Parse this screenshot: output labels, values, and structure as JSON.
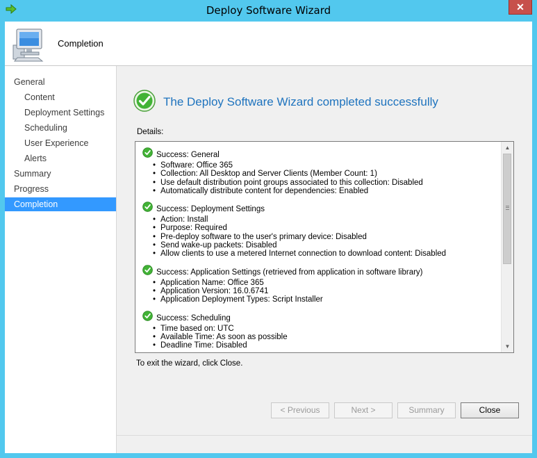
{
  "window": {
    "title": "Deploy Software Wizard",
    "close_glyph": "✕"
  },
  "header": {
    "heading": "Completion"
  },
  "sidebar": {
    "items": [
      {
        "label": "General",
        "level": "top",
        "active": false
      },
      {
        "label": "Content",
        "level": "sub",
        "active": false
      },
      {
        "label": "Deployment Settings",
        "level": "sub",
        "active": false
      },
      {
        "label": "Scheduling",
        "level": "sub",
        "active": false
      },
      {
        "label": "User Experience",
        "level": "sub",
        "active": false
      },
      {
        "label": "Alerts",
        "level": "sub",
        "active": false
      },
      {
        "label": "Summary",
        "level": "top",
        "active": false
      },
      {
        "label": "Progress",
        "level": "top",
        "active": false
      },
      {
        "label": "Completion",
        "level": "top",
        "active": true
      }
    ]
  },
  "main": {
    "success_title": "The Deploy Software Wizard completed successfully",
    "details_label": "Details:",
    "sections": [
      {
        "heading": "Success: General",
        "items": [
          "Software: Office 365",
          "Collection: All Desktop and Server Clients (Member Count: 1)",
          "Use default distribution point groups associated to this collection: Disabled",
          "Automatically distribute content for dependencies: Enabled"
        ]
      },
      {
        "heading": "Success: Deployment Settings",
        "items": [
          "Action: Install",
          "Purpose: Required",
          "Pre-deploy software to the user's primary device: Disabled",
          "Send wake-up packets: Disabled",
          "Allow clients to use a metered Internet connection to download content: Disabled"
        ]
      },
      {
        "heading": "Success: Application Settings (retrieved from application in software library)",
        "items": [
          "Application Name: Office 365",
          "Application Version: 16.0.6741",
          "Application Deployment Types: Script Installer"
        ]
      },
      {
        "heading": "Success: Scheduling",
        "items": [
          "Time based on: UTC",
          "Available Time: As soon as possible",
          "Deadline Time: Disabled"
        ]
      }
    ],
    "exit_text": "To exit the wizard, click Close.",
    "scroll_position": 0.0
  },
  "buttons": {
    "previous": "< Previous",
    "next": "Next >",
    "summary": "Summary",
    "close": "Close"
  },
  "colors": {
    "title_bar": "#52c8ee",
    "accent": "#3399ff",
    "success_title": "#1e73be",
    "success_green": "#3cb043"
  }
}
